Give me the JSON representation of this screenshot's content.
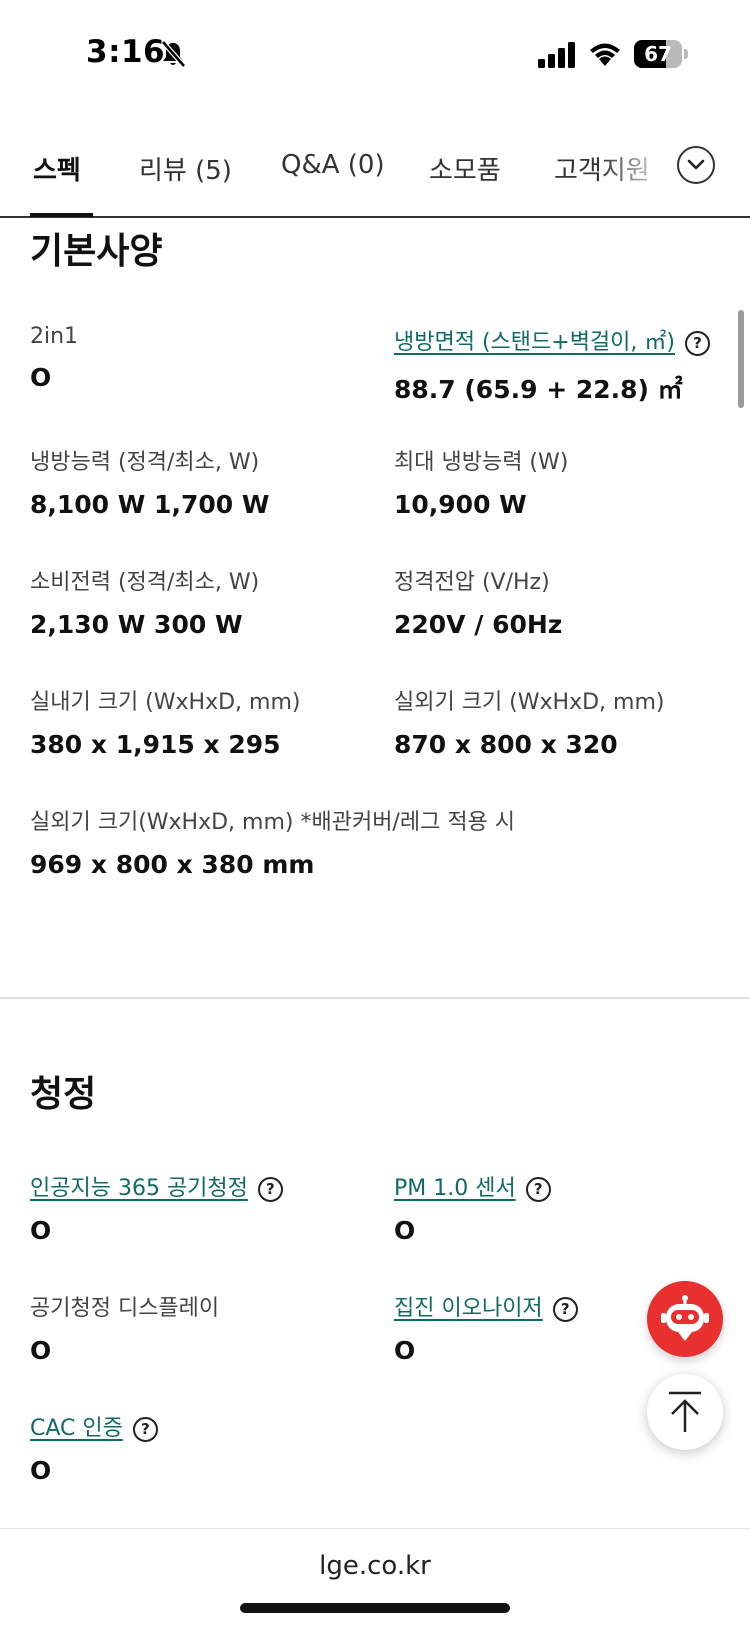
{
  "status_bar": {
    "time": "3:16",
    "battery_level": "67",
    "battery_fraction": 0.67
  },
  "tabs": [
    {
      "label": "스펙",
      "active": true
    },
    {
      "label": "리뷰 (5)",
      "active": false
    },
    {
      "label": "Q&A (0)",
      "active": false
    },
    {
      "label": "소모품",
      "active": false
    },
    {
      "label": "고객지원",
      "active": false
    }
  ],
  "sections": {
    "basic": {
      "title": "기본사양",
      "items": [
        {
          "label": "2in1",
          "value": "O"
        },
        {
          "label": "냉방면적 (스탠드+벽걸이, ㎡)",
          "value": "88.7 (65.9 + 22.8) ㎡"
        },
        {
          "label": "냉방능력 (정격/최소, W)",
          "value": "8,100 W 1,700 W"
        },
        {
          "label": "최대 냉방능력 (W)",
          "value": "10,900 W"
        },
        {
          "label": "소비전력 (정격/최소, W)",
          "value": "2,130 W 300 W"
        },
        {
          "label": "정격전압 (V/Hz)",
          "value": "220V / 60Hz"
        },
        {
          "label": "실내기 크기 (WxHxD, mm)",
          "value": "380 x 1,915 x 295"
        },
        {
          "label": "실외기 크기 (WxHxD, mm)",
          "value": "870 x 800 x 320"
        },
        {
          "label": "실외기 크기(WxHxD, mm) *배관커버/레그 적용 시",
          "value": "969 x 800 x 380 mm"
        }
      ]
    },
    "purification": {
      "title": "청정",
      "items": [
        {
          "label": "인공지능 365 공기청정",
          "value": "O"
        },
        {
          "label": "PM 1.0 센서",
          "value": "O"
        },
        {
          "label": "공기청정 디스플레이",
          "value": "O"
        },
        {
          "label": "집진 이오나이저",
          "value": "O"
        },
        {
          "label": "CAC 인증",
          "value": "O"
        }
      ]
    }
  },
  "help_glyph": "?",
  "browser": {
    "url": "lge.co.kr"
  },
  "colors": {
    "link": "#0f6b63",
    "chatbot": "#e8302e"
  }
}
